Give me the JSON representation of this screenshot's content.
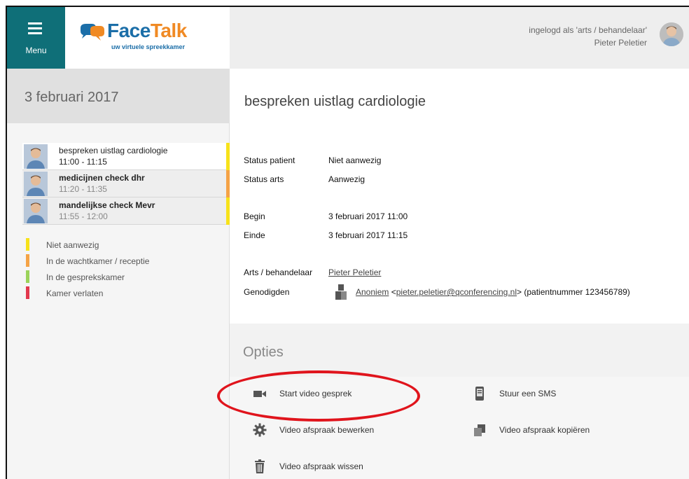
{
  "header": {
    "menu_label": "Menu",
    "brand_face": "Face",
    "brand_talk": "Talk",
    "brand_tagline": "uw virtuele spreekkamer",
    "user_line1": "ingelogd als 'arts / behandelaar'",
    "user_line2": "Pieter Peletier"
  },
  "sidebar": {
    "date": "3 februari 2017",
    "appointments": [
      {
        "title": "bespreken uistlag cardiologie",
        "time": "11:00 - 11:15",
        "status_color": "#f7e21a"
      },
      {
        "title": "medicijnen check dhr",
        "time": "11:20 - 11:35",
        "status_color": "#f5a346"
      },
      {
        "title": "mandelijkse check Mevr",
        "time": "11:55 - 12:00",
        "status_color": "#f7e21a"
      }
    ],
    "legend": [
      {
        "label": "Niet aanwezig",
        "color": "#f7e21a"
      },
      {
        "label": "In de wachtkamer / receptie",
        "color": "#f5a346"
      },
      {
        "label": "In de gesprekskamer",
        "color": "#9bd35a"
      },
      {
        "label": "Kamer verlaten",
        "color": "#e2384d"
      }
    ]
  },
  "main": {
    "title": "bespreken uistlag cardiologie",
    "status_patient_label": "Status patient",
    "status_patient_value": "Niet aanwezig",
    "status_arts_label": "Status arts",
    "status_arts_value": "Aanwezig",
    "begin_label": "Begin",
    "begin_value": "3 februari 2017 11:00",
    "einde_label": "Einde",
    "einde_value": "3 februari 2017 11:15",
    "arts_label": "Arts / behandelaar",
    "arts_value": "Pieter Peletier",
    "genodigden_label": "Genodigden",
    "guest_name": "Anoniem",
    "guest_lt": "<",
    "guest_email": "pieter.peletier@qconferencing.nl",
    "guest_suffix": "> (patientnummer 123456789)"
  },
  "options": {
    "title": "Opties",
    "start_video": "Start video gesprek",
    "sms": "Stuur een SMS",
    "edit": "Video afspraak bewerken",
    "copy": "Video afspraak kopiëren",
    "delete": "Video afspraak wissen"
  },
  "colors": {
    "menu_bg": "#0f6f78",
    "brand_blue": "#1b6ea8",
    "brand_orange": "#f08a24",
    "highlight": "#e0141c"
  }
}
